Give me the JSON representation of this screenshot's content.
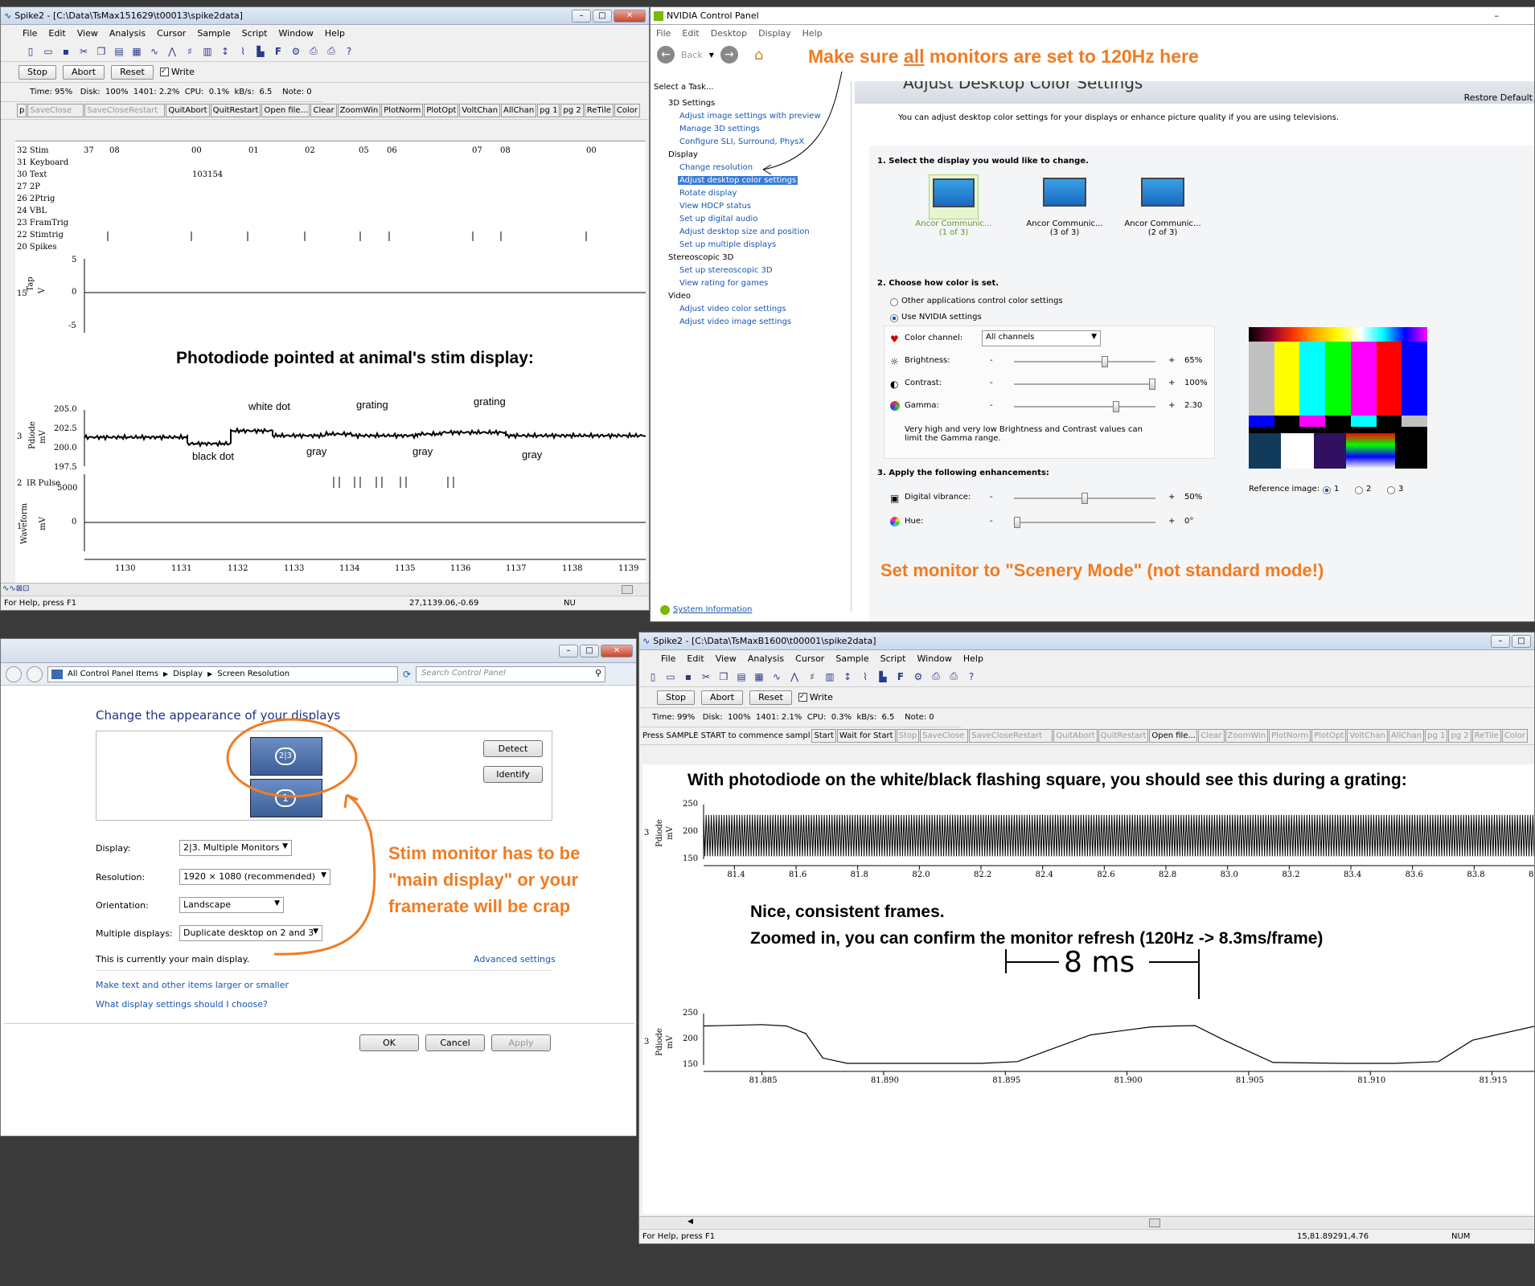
{
  "spike1": {
    "title": "Spike2 - [C:\\Data\\TsMax151629\\t00013\\spike2data]",
    "menu": [
      "File",
      "Edit",
      "View",
      "Analysis",
      "Cursor",
      "Sample",
      "Script",
      "Window",
      "Help"
    ],
    "buttons": {
      "stop": "Stop",
      "abort": "Abort",
      "reset": "Reset",
      "write": "Write"
    },
    "status_line": "Time: 95%   Disk:  100%  1401: 2.2%  CPU:  0.1%  kB/s:  6.5    Note: 0",
    "cmd_buttons": [
      "p",
      "SaveClose",
      "SaveCloseRestart",
      "QuitAbort",
      "QuitRestart",
      "Open file...",
      "Clear",
      "ZoomWin",
      "PlotNorm",
      "PlotOpt",
      "VoltChan",
      "AllChan",
      "pg 1",
      "pg 2",
      "ReTile",
      "Color"
    ],
    "stim_ticks": [
      "37",
      "08",
      "00",
      "01",
      "02",
      "05",
      "06",
      "07",
      "08",
      "00"
    ],
    "text_mark": "103154",
    "channels": [
      "32 Stim",
      "31 Keyboard",
      "30 Text",
      "27 2P",
      "26 2Ptrig",
      "24 VBL",
      "23 FramTrig",
      "22 Stimtrig",
      "20 Spikes"
    ],
    "ch15": {
      "num": "15",
      "name": "Tap",
      "unit": "V",
      "ticks": [
        "5",
        "0",
        "-5"
      ]
    },
    "ch3": {
      "num": "3",
      "name": "Pdiode",
      "unit": "mV",
      "ticks": [
        "205.0",
        "202.5",
        "200.0",
        "197.5"
      ]
    },
    "ch2": {
      "num": "2",
      "name": "IR Pulse"
    },
    "ch1": {
      "num": "1",
      "name": "Waveform",
      "unit": "mV",
      "ticks": [
        "5000",
        "0"
      ]
    },
    "xticks": [
      "1130",
      "1131",
      "1132",
      "1133",
      "1134",
      "1135",
      "1136",
      "1137",
      "1138",
      "1139"
    ],
    "status_help": "For Help, press F1",
    "status_coords": "27,1139.06,-0.69",
    "status_num": "NU",
    "annotations": {
      "title": "Photodiode pointed at animal's stim display:",
      "white_dot": "white dot",
      "grating1": "grating",
      "grating2": "grating",
      "black_dot": "black dot",
      "gray1": "gray",
      "gray2": "gray",
      "gray3": "gray"
    }
  },
  "nvidia": {
    "title": "NVIDIA Control Panel",
    "menu": [
      "File",
      "Edit",
      "Desktop",
      "Display",
      "Help"
    ],
    "back": "Back",
    "note": "Make sure all monitors are set to 120Hz here",
    "note_parts": [
      "Make sure ",
      "all",
      " monitors are set to 120Hz here"
    ],
    "select_task": "Select a Task...",
    "tree": [
      {
        "head": "3D Settings",
        "items": [
          "Adjust image settings with preview",
          "Manage 3D settings",
          "Configure SLI, Surround, PhysX"
        ]
      },
      {
        "head": "Display",
        "items": [
          "Change resolution",
          "Adjust desktop color settings",
          "Rotate display",
          "View HDCP status",
          "Set up digital audio",
          "Adjust desktop size and position",
          "Set up multiple displays"
        ]
      },
      {
        "head": "Stereoscopic 3D",
        "items": [
          "Set up stereoscopic 3D",
          "View rating for games"
        ]
      },
      {
        "head": "Video",
        "items": [
          "Adjust video color settings",
          "Adjust video image settings"
        ]
      }
    ],
    "sysinfo": "System Information",
    "page_title": "Adjust Desktop Color Settings",
    "restore": "Restore Default",
    "desc": "You can adjust desktop color settings for your displays or enhance picture quality if you are using televisions.",
    "step1": "1. Select the display you would like to change.",
    "monitors": [
      {
        "name": "Ancor Communic...",
        "sub": "(1 of 3)",
        "selected": true
      },
      {
        "name": "Ancor Communic...",
        "sub": "(3 of 3)",
        "selected": false
      },
      {
        "name": "Ancor Communic...",
        "sub": "(2 of 3)",
        "selected": false
      }
    ],
    "step2": "2. Choose how color is set.",
    "radio_other": "Other applications control color settings",
    "radio_nvidia": "Use NVIDIA settings",
    "color_channel_label": "Color channel:",
    "color_channel_value": "All channels",
    "brightness_label": "Brightness:",
    "brightness_value": "65%",
    "brightness_level": 0.65,
    "contrast_label": "Contrast:",
    "contrast_value": "100%",
    "contrast_level": 1.0,
    "gamma_label": "Gamma:",
    "gamma_value": "2.30",
    "gamma_level": 0.73,
    "warn": "Very high and very low Brightness and Contrast values can limit the Gamma range.",
    "step3": "3. Apply the following enhancements:",
    "vibrance_label": "Digital vibrance:",
    "vibrance_value": "50%",
    "vibrance_level": 0.5,
    "hue_label": "Hue:",
    "hue_value": "0°",
    "hue_level": 0.0,
    "ref_label": "Reference image:",
    "ref_options": [
      "1",
      "2",
      "3"
    ],
    "minus": "-",
    "plus": "+",
    "scenery_note": "Set monitor to \"Scenery Mode\" (not standard mode!)"
  },
  "screenres": {
    "address": [
      "All Control Panel Items",
      "Display",
      "Screen Resolution"
    ],
    "search_placeholder": "Search Control Panel",
    "heading": "Change the appearance of your displays",
    "detect": "Detect",
    "identify": "Identify",
    "monitor_label_top": "2|3",
    "monitor_label_bottom": "1",
    "display_label": "Display:",
    "display_value": "2|3. Multiple Monitors",
    "resolution_label": "Resolution:",
    "resolution_value": "1920 × 1080 (recommended)",
    "orientation_label": "Orientation:",
    "orientation_value": "Landscape",
    "multiple_label": "Multiple displays:",
    "multiple_value": "Duplicate desktop on 2 and 3",
    "main_display": "This is currently your main display.",
    "advanced": "Advanced settings",
    "link1": "Make text and other items larger or smaller",
    "link2": "What display settings should I choose?",
    "ok": "OK",
    "cancel": "Cancel",
    "apply": "Apply",
    "note": [
      "Stim monitor has to be",
      "\"main display\" or your",
      "framerate will be crap"
    ]
  },
  "spike2": {
    "title": "Spike2 - [C:\\Data\\TsMaxB1600\\t00001\\spike2data]",
    "menu": [
      "File",
      "Edit",
      "View",
      "Analysis",
      "Cursor",
      "Sample",
      "Script",
      "Window",
      "Help"
    ],
    "buttons": {
      "stop": "Stop",
      "abort": "Abort",
      "reset": "Reset",
      "write": "Write"
    },
    "status_line": "Time: 99%   Disk:  100%  1401: 2.1%  CPU:  0.3%  kB/s:  6.5    Note: 0",
    "cmd_prompt": "Press SAMPLE START to commence sampl",
    "cmd_buttons": [
      "Start",
      "Wait for Start",
      "Stop",
      "SaveClose",
      "SaveCloseRestart",
      "QuitAbort",
      "QuitRestart",
      "Open file...",
      "Clear",
      "ZoomWin",
      "PlotNorm",
      "PlotOpt",
      "VoltChan",
      "AllChan",
      "pg 1",
      "pg 2",
      "ReTile",
      "Color"
    ],
    "plot1_title": "With photodiode on the white/black flashing square, you should see this during a grating:",
    "plot1_ch": {
      "num": "3",
      "name": "Pdiode",
      "unit": "mV",
      "ticks": [
        "250",
        "200",
        "150"
      ]
    },
    "plot1_xticks": [
      "81.4",
      "81.6",
      "81.8",
      "82.0",
      "82.2",
      "82.4",
      "82.6",
      "82.8",
      "83.0",
      "83.2",
      "83.4",
      "83.6",
      "83.8",
      "84.0"
    ],
    "nice": "Nice, consistent frames.",
    "zoomed": "Zoomed in, you can confirm the monitor refresh (120Hz -> 8.3ms/frame)",
    "hand_label": "8 ms",
    "plot2_ch": {
      "num": "3",
      "name": "Pdiode",
      "unit": "mV",
      "ticks": [
        "250",
        "200",
        "150"
      ]
    },
    "plot2_xticks": [
      "81.885",
      "81.890",
      "81.895",
      "81.900",
      "81.905",
      "81.910",
      "81.915"
    ],
    "status_help": "For Help, press F1",
    "status_coords": "15,81.89291,4.76",
    "status_num": "NUM"
  },
  "chart_data": [
    {
      "type": "line",
      "title": "",
      "ylabel": "Pdiode mV",
      "xlabel": "",
      "x_ticks": [
        81.4,
        81.6,
        81.8,
        82.0,
        82.2,
        82.4,
        82.6,
        82.8,
        83.0,
        83.2,
        83.4,
        83.6,
        83.8,
        84.0
      ],
      "xlim": [
        81.3,
        84.0
      ],
      "ylim": [
        130,
        260
      ],
      "description_series": {
        "name": "",
        "x_start": 81.3,
        "x_end": 84.0,
        "period": 0.00833,
        "min": 150,
        "max": 238
      }
    },
    {
      "type": "line",
      "title": "",
      "ylabel": "Pdiode mV",
      "xlim": [
        81.8826,
        81.9168
      ],
      "ylim": [
        130,
        260
      ],
      "series": [
        {
          "name": "",
          "x": [
            81.8826,
            81.885,
            81.886,
            81.8868,
            81.8875,
            81.8885,
            81.891,
            81.894,
            81.8955,
            81.8965,
            81.8985,
            81.901,
            81.902,
            81.9028,
            81.904,
            81.906,
            81.909,
            81.911,
            81.9128,
            81.9142,
            81.9168
          ],
          "y": [
            232,
            235,
            232,
            215,
            160,
            148,
            148,
            148,
            152,
            172,
            212,
            230,
            232,
            233,
            200,
            150,
            148,
            148,
            152,
            200,
            232
          ]
        }
      ]
    }
  ]
}
